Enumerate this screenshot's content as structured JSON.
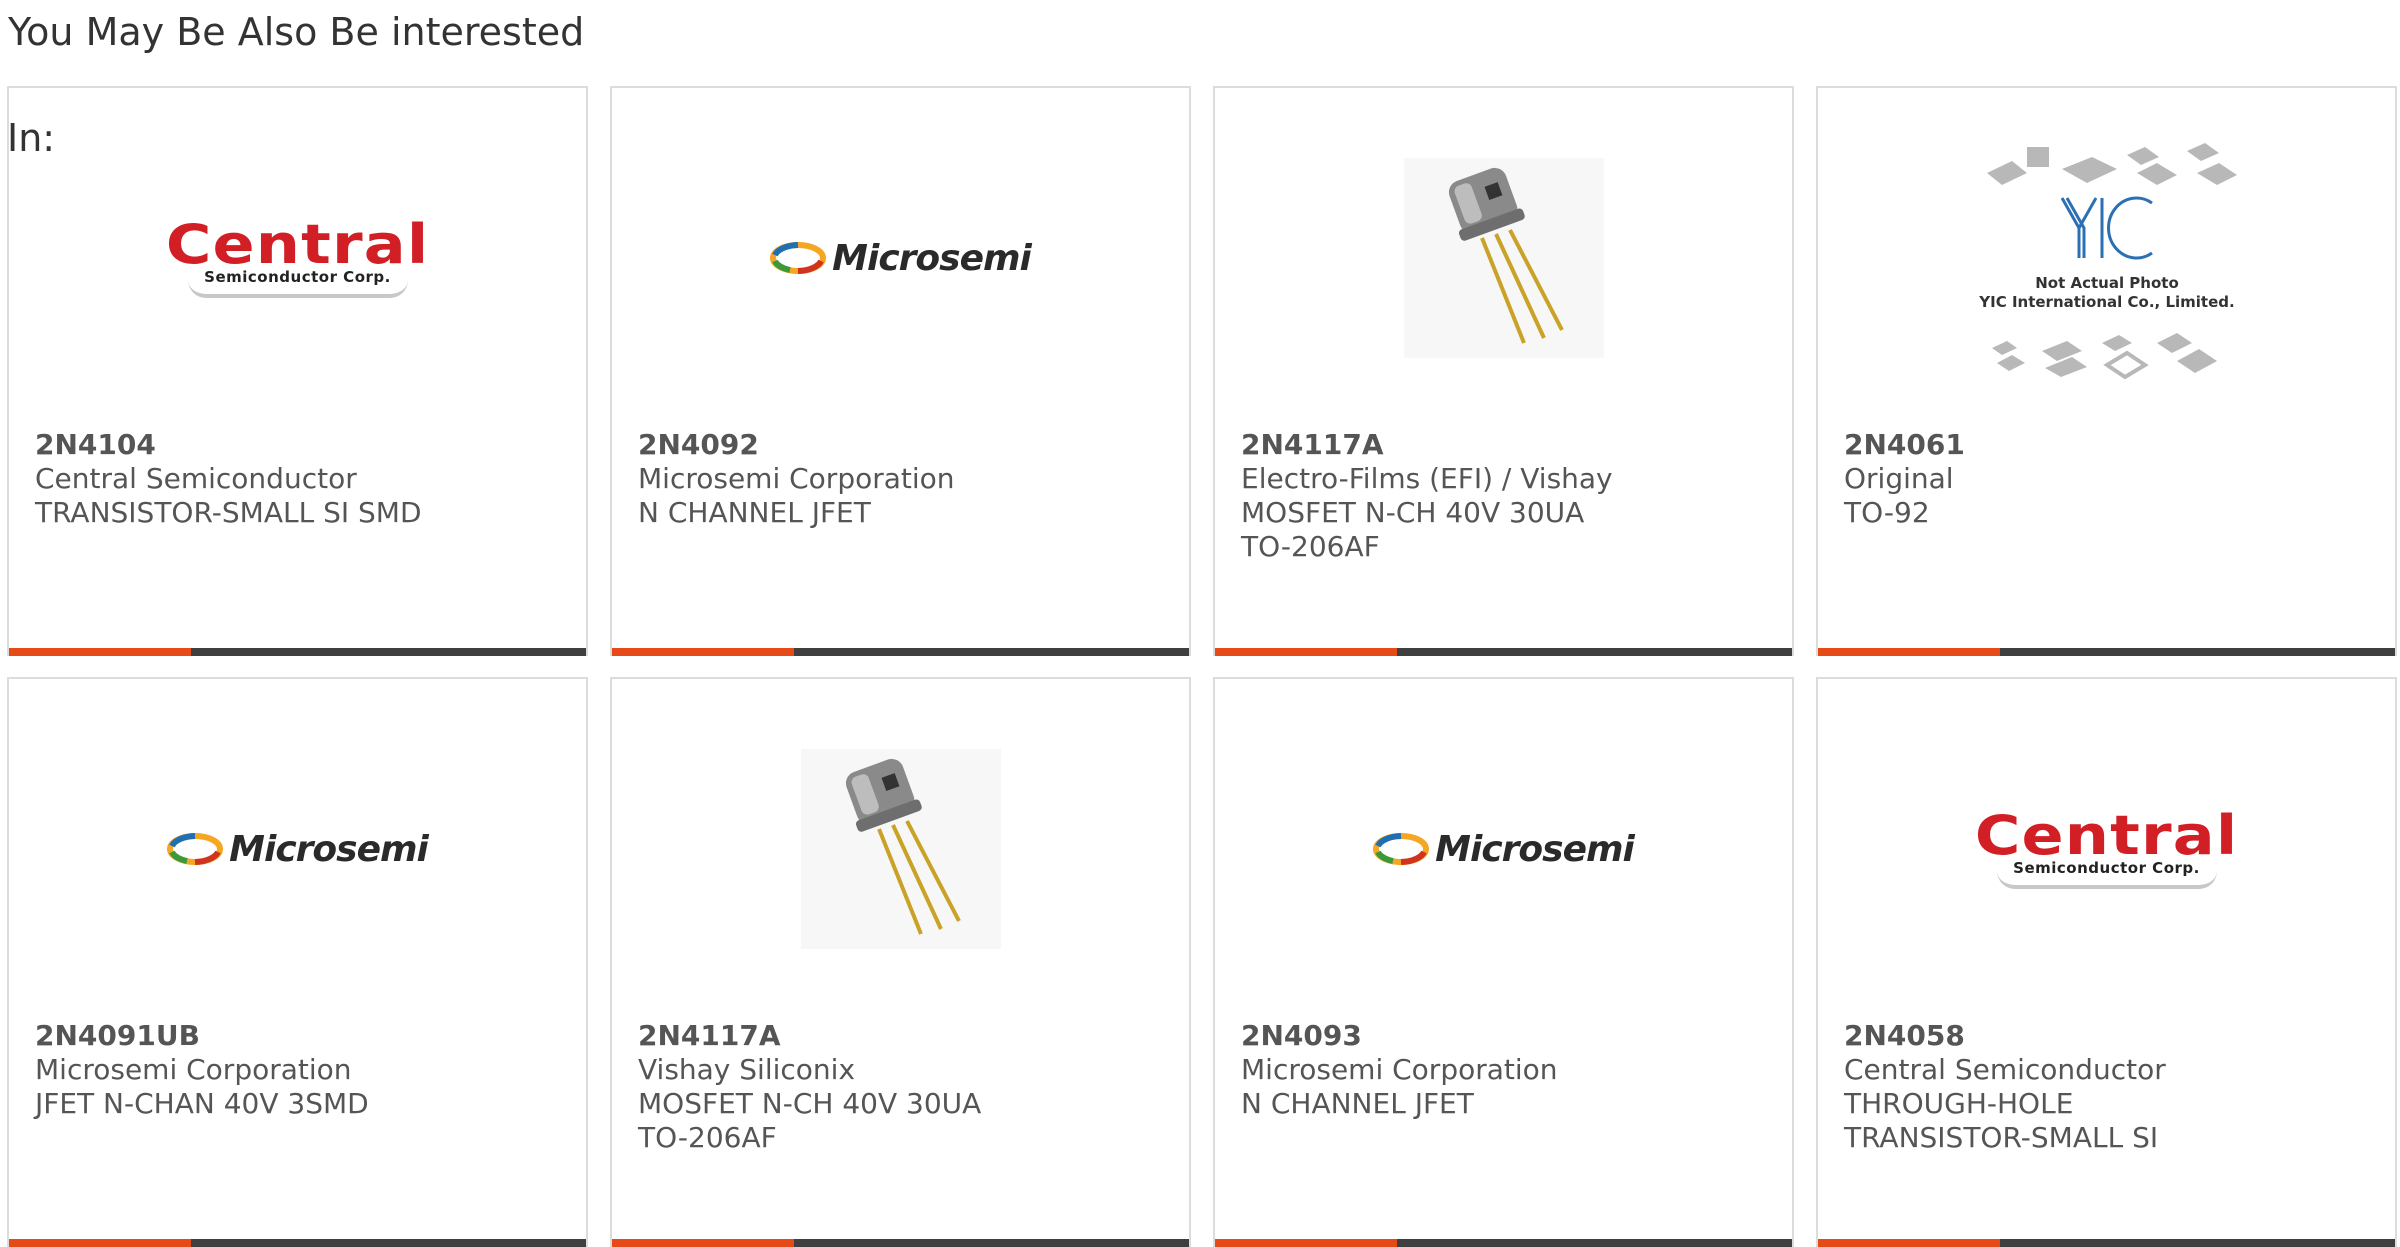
{
  "section": {
    "title": "You May Be Also Be interested",
    "in_label": "In:"
  },
  "colors": {
    "accent": "#e64a19",
    "bar": "#3f3f3f",
    "central_red": "#d21f26",
    "yic_blue": "#2b6fb5"
  },
  "cards": [
    {
      "part": "2N4104",
      "maker": "Central Semiconductor",
      "desc": "TRANSISTOR-SMALL SI SMD",
      "image": "central-logo",
      "logo_word": "Central",
      "logo_sub": "Semiconductor Corp."
    },
    {
      "part": "2N4092",
      "maker": "Microsemi Corporation",
      "desc": "N CHANNEL JFET",
      "image": "microsemi-logo",
      "logo_word": "Microsemi"
    },
    {
      "part": "2N4117A",
      "maker": "Electro-Films (EFI) / Vishay",
      "desc": "MOSFET N-CH 40V 30UA TO-206AF",
      "image": "to-can-photo"
    },
    {
      "part": "2N4061",
      "maker": "Original",
      "desc": "TO-92",
      "image": "yic-placeholder",
      "photo_line1": "Not Actual Photo",
      "photo_line2": "YIC International Co., Limited."
    },
    {
      "part": "2N4091UB",
      "maker": "Microsemi Corporation",
      "desc": "JFET N-CHAN 40V 3SMD",
      "image": "microsemi-logo",
      "logo_word": "Microsemi"
    },
    {
      "part": "2N4117A",
      "maker": "Vishay Siliconix",
      "desc": "MOSFET N-CH 40V 30UA TO-206AF",
      "image": "to-can-photo"
    },
    {
      "part": "2N4093",
      "maker": "Microsemi Corporation",
      "desc": "N CHANNEL JFET",
      "image": "microsemi-logo",
      "logo_word": "Microsemi"
    },
    {
      "part": "2N4058",
      "maker": "Central Semiconductor",
      "desc": "THROUGH-HOLE TRANSISTOR-SMALL SI",
      "image": "central-logo",
      "logo_word": "Central",
      "logo_sub": "Semiconductor Corp."
    }
  ]
}
